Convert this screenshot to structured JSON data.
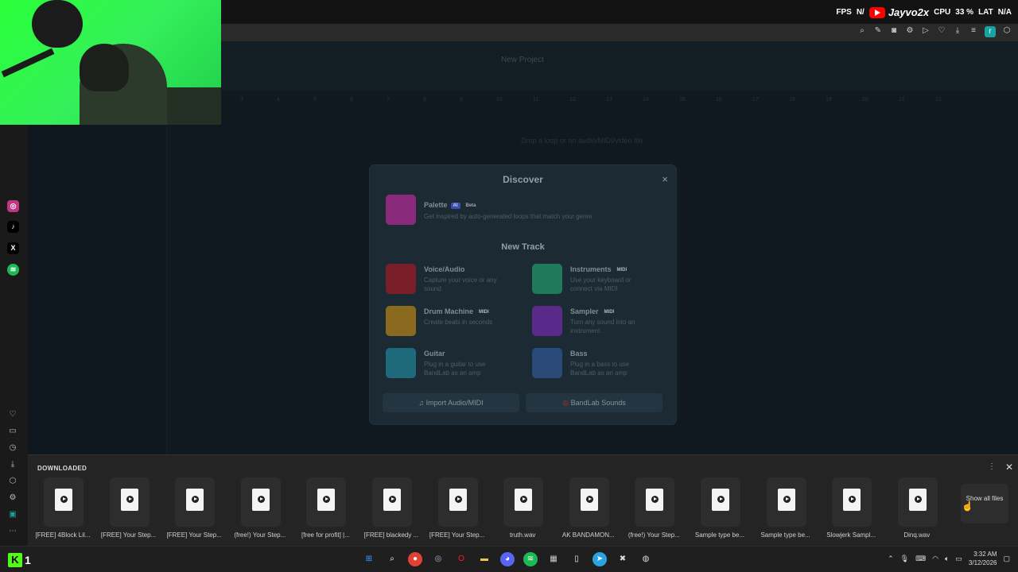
{
  "overlay": {
    "fps_label": "FPS",
    "fps_value": "N/",
    "youtube_name": "Jayvo2x",
    "cpu_label": "CPU",
    "cpu_value": "33 %",
    "lat_label": "LAT",
    "lat_value": "N/A"
  },
  "app": {
    "project_title": "New Project",
    "drop_hint": "Drop a loop or an audio/MIDI/video file",
    "ruler_ticks": [
      "1",
      "2",
      "3",
      "4",
      "5",
      "6",
      "7",
      "8",
      "9",
      "10",
      "11",
      "12",
      "13",
      "14",
      "15",
      "16",
      "17",
      "18",
      "19",
      "20",
      "21",
      "22"
    ]
  },
  "modal": {
    "title": "Discover",
    "close": "×",
    "palette": {
      "title": "Palette",
      "ai_tag": "AI",
      "beta_tag": "Beta",
      "desc": "Get inspired by auto-generated loops that match your genre"
    },
    "new_track_title": "New Track",
    "items": [
      {
        "title": "Voice/Audio",
        "tag": "",
        "desc": "Capture your voice or any sound",
        "color": "#7a1f2a",
        "icon": "microphone-icon"
      },
      {
        "title": "Instruments",
        "tag": "MIDI",
        "desc": "Use your keyboard or connect via MIDI",
        "color": "#1e7a5a",
        "icon": "keyboard-icon"
      },
      {
        "title": "Drum Machine",
        "tag": "MIDI",
        "desc": "Create beats in seconds",
        "color": "#8a6a1e",
        "icon": "drum-machine-icon"
      },
      {
        "title": "Sampler",
        "tag": "MIDI",
        "desc": "Turn any sound into an instrument",
        "color": "#5a2a8a",
        "icon": "waveform-icon"
      },
      {
        "title": "Guitar",
        "tag": "",
        "desc": "Plug in a guitar to use BandLab as an amp",
        "color": "#1e6a7a",
        "icon": "guitar-icon"
      },
      {
        "title": "Bass",
        "tag": "",
        "desc": "Plug in a bass to use BandLab as an amp",
        "color": "#2a4a7a",
        "icon": "bass-icon"
      }
    ],
    "import_label": "Import Audio/MIDI",
    "sounds_label": "BandLab Sounds"
  },
  "shelf": {
    "title": "DOWNLOADED",
    "show_all": "Show all files",
    "files": [
      "[FREE] 4Block Lil...",
      "[FREE] Your Step...",
      "[FREE] Your Step...",
      "(free!) Your Step...",
      "[free for profit] |...",
      "[FREE] blackedy ...",
      "[FREE] Your Step...",
      "truth.wav",
      "AK BANDAMON...",
      "(free!) Your Step...",
      "Sample type be...",
      "Sample type be...",
      "Slowjerk Sampl...",
      "Dinq.wav"
    ]
  },
  "taskbar": {
    "kick_number": "1",
    "time": "3:32 AM",
    "date": "3/12/2026"
  }
}
